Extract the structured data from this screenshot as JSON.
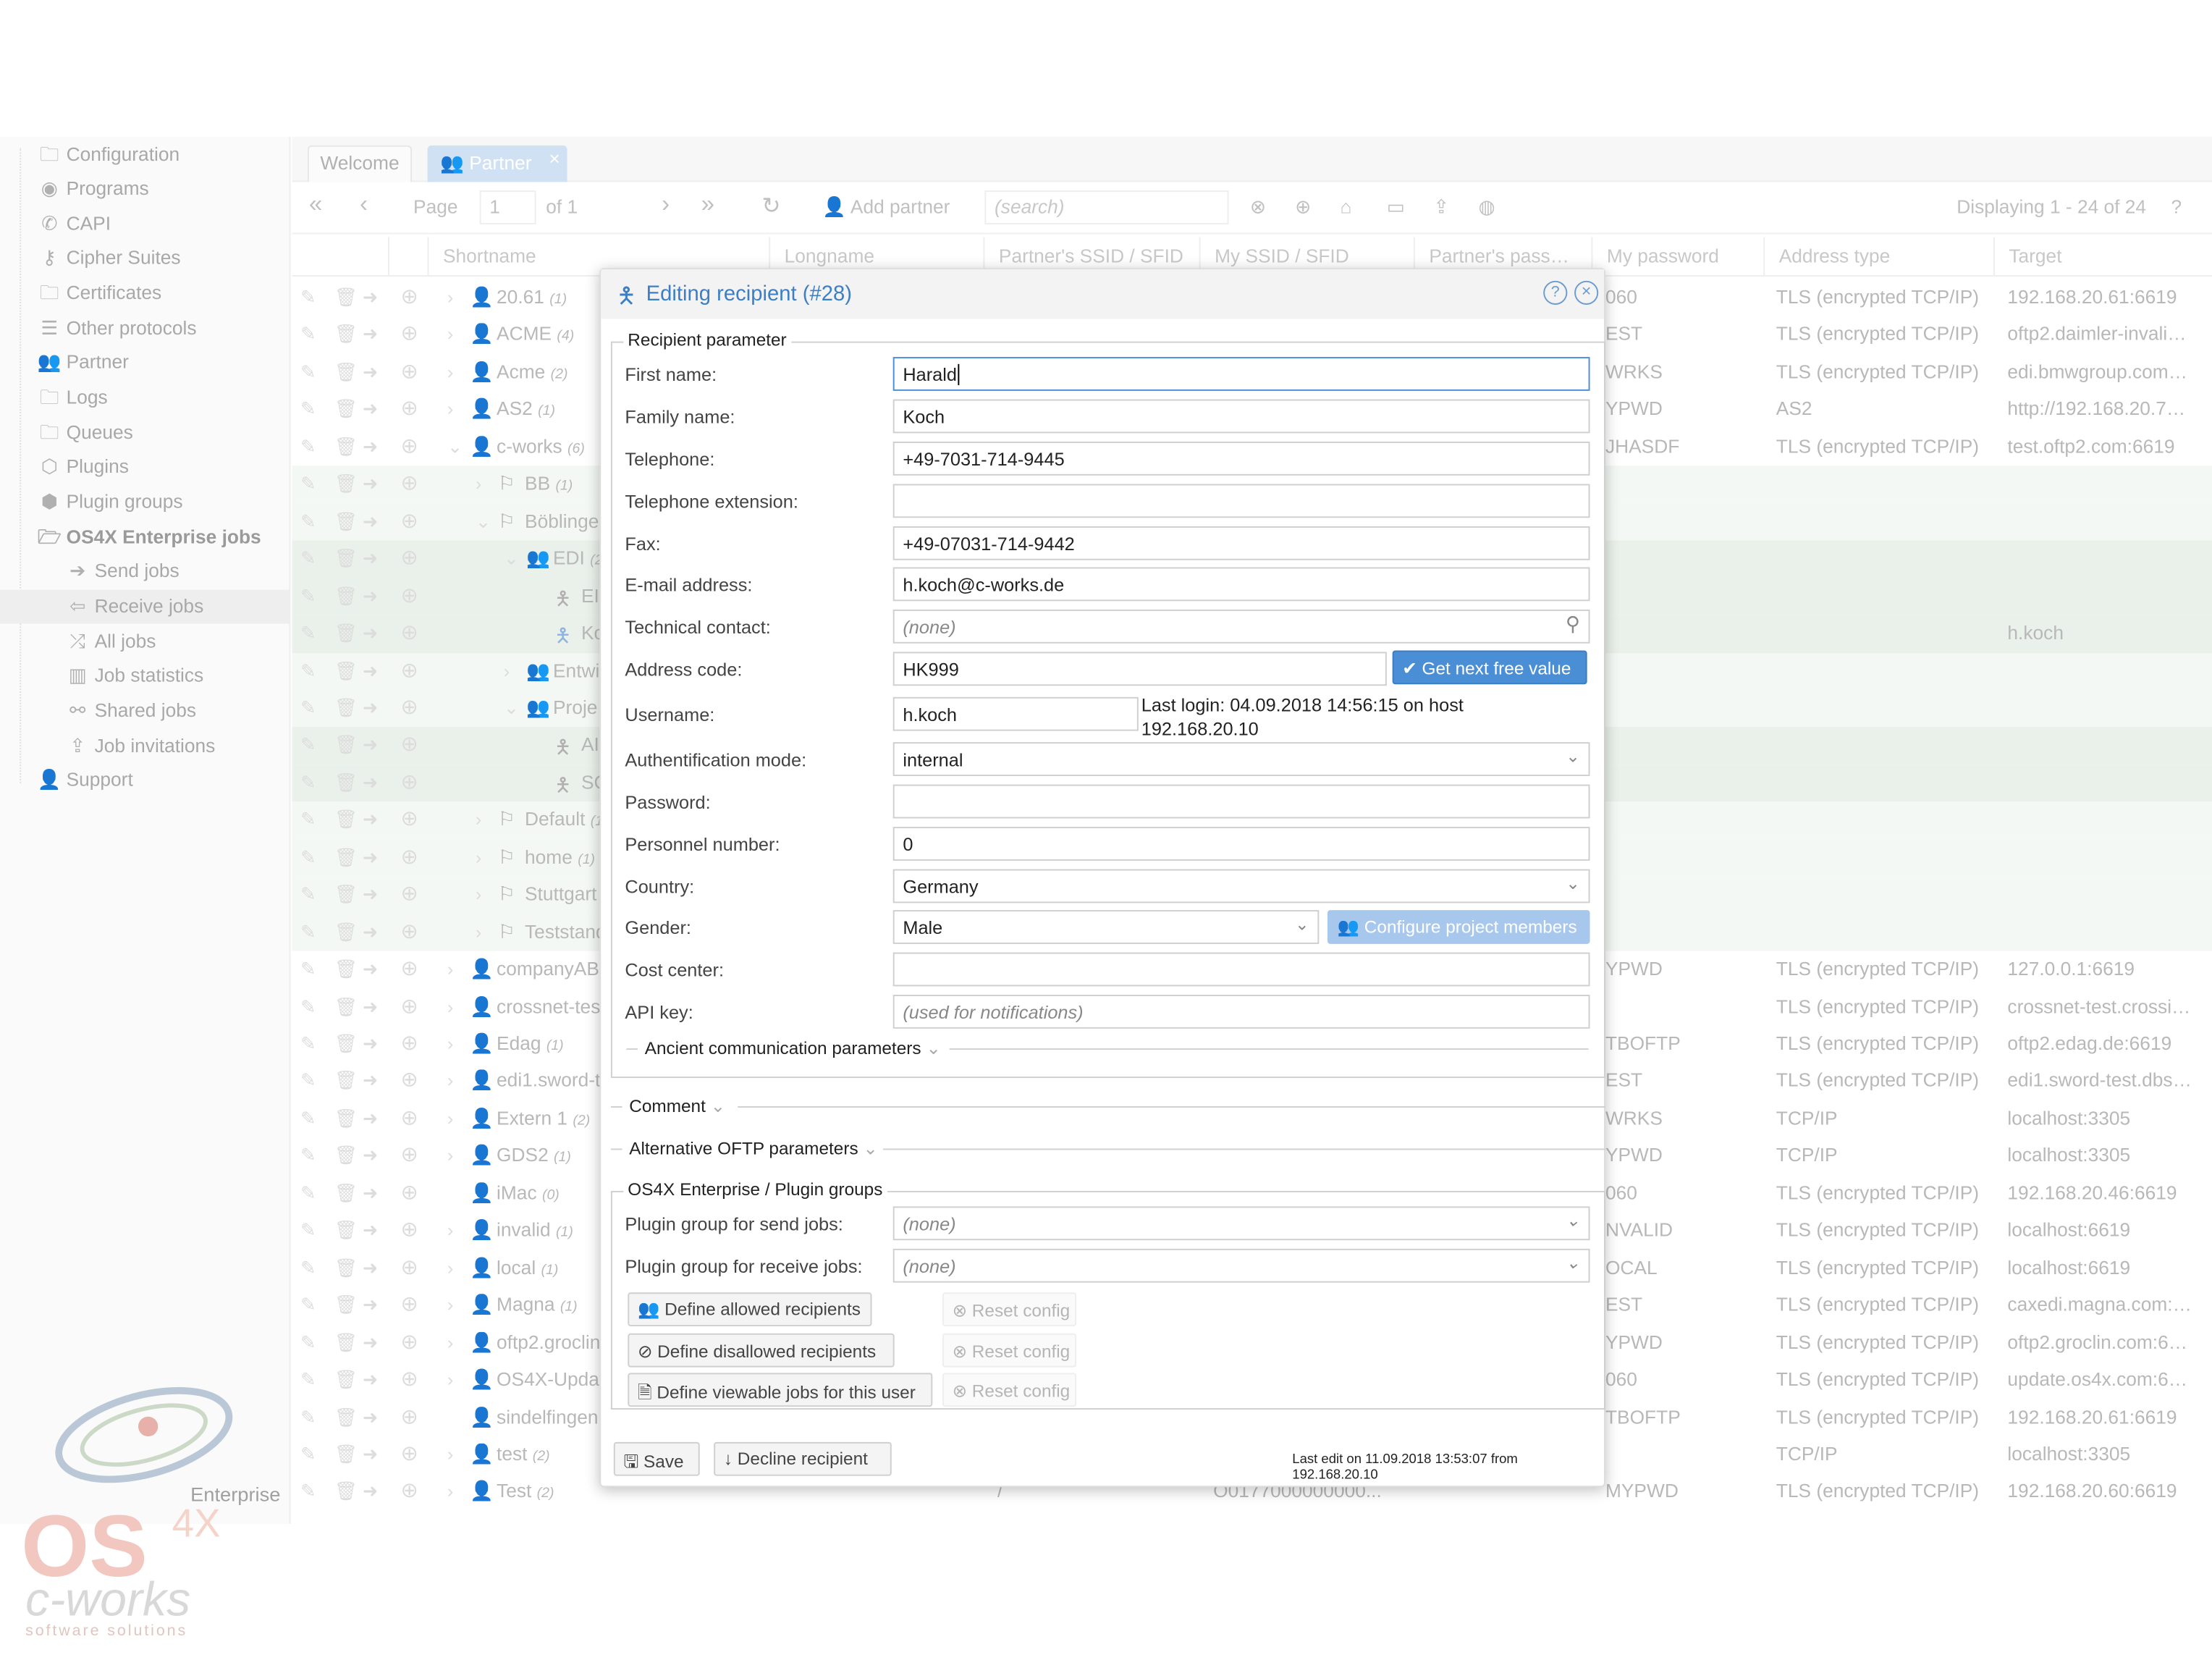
{
  "sidebar": {
    "items": [
      {
        "label": "Configuration",
        "icon": "folder-icon"
      },
      {
        "label": "Programs",
        "icon": "programs-icon"
      },
      {
        "label": "CAPI",
        "icon": "phone-icon"
      },
      {
        "label": "Cipher Suites",
        "icon": "key-icon"
      },
      {
        "label": "Certificates",
        "icon": "folder-icon"
      },
      {
        "label": "Other protocols",
        "icon": "server-icon"
      },
      {
        "label": "Partner",
        "icon": "users-icon"
      },
      {
        "label": "Logs",
        "icon": "folder-icon"
      },
      {
        "label": "Queues",
        "icon": "folder-icon"
      },
      {
        "label": "Plugins",
        "icon": "cube-icon"
      },
      {
        "label": "Plugin groups",
        "icon": "cubes-icon"
      },
      {
        "label": "OS4X Enterprise jobs",
        "icon": "folder-open-icon"
      },
      {
        "label": "Send jobs",
        "icon": "arrow-right-icon"
      },
      {
        "label": "Receive jobs",
        "icon": "arrow-left-icon",
        "selected": true
      },
      {
        "label": "All jobs",
        "icon": "shuffle-icon"
      },
      {
        "label": "Job statistics",
        "icon": "bar-chart-icon"
      },
      {
        "label": "Shared jobs",
        "icon": "share-icon"
      },
      {
        "label": "Job invitations",
        "icon": "upload-icon"
      },
      {
        "label": "Support",
        "icon": "user-icon"
      }
    ],
    "logo": {
      "text": "OS4X",
      "badge": "4X",
      "edition": "Enterprise",
      "company": "c-works",
      "tagline": "software solutions"
    }
  },
  "tabs": [
    {
      "label": "Welcome"
    },
    {
      "label": "Partner",
      "active": true,
      "close": "×"
    }
  ],
  "toolbar": {
    "page_label": "Page",
    "page_value": "1",
    "of_label": "of 1",
    "add_partner": "Add partner",
    "search_placeholder": "(search)",
    "displaying": "Displaying 1 - 24 of 24"
  },
  "grid": {
    "columns": [
      "Shortname",
      "Longname",
      "Partner's SSID / SFID",
      "My SSID / SFID",
      "Partner's pass…",
      "My password",
      "Address type",
      "Target"
    ],
    "rows": [
      {
        "name": "20.61",
        "count": "(1)",
        "level": 0,
        "type": "partner",
        "pwd": "060",
        "addr": "TLS (encrypted TCP/IP)",
        "target": "192.168.20.61:6619"
      },
      {
        "name": "ACME",
        "count": "(4)",
        "level": 0,
        "type": "partner",
        "pwd": "EST",
        "addr": "TLS (encrypted TCP/IP)",
        "target": "oftp2.daimler-invali…"
      },
      {
        "name": "Acme",
        "count": "(2)",
        "level": 0,
        "type": "partner",
        "pwd": "WRKS",
        "addr": "TLS (encrypted TCP/IP)",
        "target": "edi.bmwgroup.com…"
      },
      {
        "name": "AS2",
        "count": "(1)",
        "level": 0,
        "type": "partner",
        "pwd": "YPWD",
        "addr": "AS2",
        "target": "http://192.168.20.7…"
      },
      {
        "name": "c-works",
        "count": "(6)",
        "level": 0,
        "type": "partner",
        "expanded": true,
        "pwd": "JHASDF",
        "addr": "TLS (encrypted TCP/IP)",
        "target": "test.oftp2.com:6619"
      },
      {
        "name": "BB",
        "count": "(1)",
        "level": 1,
        "type": "flag",
        "tint": 1
      },
      {
        "name": "Böblingen",
        "count": "",
        "level": 1,
        "type": "flag",
        "expanded": true,
        "tint": 1
      },
      {
        "name": "EDI",
        "count": "(2)",
        "level": 2,
        "type": "group",
        "expanded": true,
        "tint": 2
      },
      {
        "name": "EI",
        "count": "",
        "level": 3,
        "type": "person",
        "tint": 2
      },
      {
        "name": "Ko",
        "count": "",
        "level": 3,
        "type": "person",
        "blue": true,
        "tint": 2,
        "target": "h.koch"
      },
      {
        "name": "Entwi",
        "count": "",
        "level": 2,
        "type": "group",
        "tint": 1
      },
      {
        "name": "Proje",
        "count": "",
        "level": 2,
        "type": "group",
        "expanded": true,
        "tint": 1
      },
      {
        "name": "AI",
        "count": "",
        "level": 3,
        "type": "person",
        "tint": 2
      },
      {
        "name": "SC",
        "count": "",
        "level": 3,
        "type": "person",
        "tint": 2
      },
      {
        "name": "Default",
        "count": "(1)",
        "level": 1,
        "type": "flag",
        "tint": 1
      },
      {
        "name": "home",
        "count": "(1)",
        "level": 1,
        "type": "flag",
        "tint": 1
      },
      {
        "name": "Stuttgart",
        "count": "",
        "level": 1,
        "type": "flag",
        "tint": 1
      },
      {
        "name": "Teststand",
        "count": "",
        "level": 1,
        "type": "flag",
        "tint": 1
      },
      {
        "name": "companyAB",
        "count": "",
        "level": 0,
        "type": "partner",
        "pwd": "YPWD",
        "addr": "TLS (encrypted TCP/IP)",
        "target": "127.0.0.1:6619"
      },
      {
        "name": "crossnet-tes",
        "count": "",
        "level": 0,
        "type": "partner",
        "pwd": "",
        "addr": "TLS (encrypted TCP/IP)",
        "target": "crossnet-test.crossi…"
      },
      {
        "name": "Edag",
        "count": "(1)",
        "level": 0,
        "type": "partner",
        "pwd": "TBOFTP",
        "addr": "TLS (encrypted TCP/IP)",
        "target": "oftp2.edag.de:6619"
      },
      {
        "name": "edi1.sword-t",
        "count": "",
        "level": 0,
        "type": "partner",
        "pwd": "EST",
        "addr": "TLS (encrypted TCP/IP)",
        "target": "edi1.sword-test.dbs…"
      },
      {
        "name": "Extern 1",
        "count": "(2)",
        "level": 0,
        "type": "partner",
        "pwd": "WRKS",
        "addr": "TCP/IP",
        "target": "localhost:3305"
      },
      {
        "name": "GDS2",
        "count": "(1)",
        "level": 0,
        "type": "partner",
        "pwd": "YPWD",
        "addr": "TCP/IP",
        "target": "localhost:3305"
      },
      {
        "name": "iMac",
        "count": "(0)",
        "level": 0,
        "type": "partner",
        "noexp": true,
        "pwd": "060",
        "addr": "TLS (encrypted TCP/IP)",
        "target": "192.168.20.46:6619"
      },
      {
        "name": "invalid",
        "count": "(1)",
        "level": 0,
        "type": "partner",
        "pwd": "NVALID",
        "addr": "TLS (encrypted TCP/IP)",
        "target": "localhost:6619"
      },
      {
        "name": "local",
        "count": "(1)",
        "level": 0,
        "type": "partner",
        "pwd": "OCAL",
        "addr": "TLS (encrypted TCP/IP)",
        "target": "localhost:6619"
      },
      {
        "name": "Magna",
        "count": "(1)",
        "level": 0,
        "type": "partner",
        "pwd": "EST",
        "addr": "TLS (encrypted TCP/IP)",
        "target": "caxedi.magna.com:…"
      },
      {
        "name": "oftp2.groclin",
        "count": "",
        "level": 0,
        "type": "partner",
        "pwd": "YPWD",
        "addr": "TLS (encrypted TCP/IP)",
        "target": "oftp2.groclin.com:6…"
      },
      {
        "name": "OS4X-Updat",
        "count": "",
        "level": 0,
        "type": "partner",
        "pwd": "060",
        "addr": "TLS (encrypted TCP/IP)",
        "target": "update.os4x.com:6…"
      },
      {
        "name": "sindelfingen",
        "count": "",
        "level": 0,
        "type": "partner",
        "noexp": true,
        "pwd": "TBOFTP",
        "addr": "TLS (encrypted TCP/IP)",
        "target": "192.168.20.61:6619"
      },
      {
        "name": "test",
        "count": "(2)",
        "level": 0,
        "type": "partner",
        "pwd": "",
        "addr": "TCP/IP",
        "target": "localhost:3305"
      },
      {
        "name": "Test",
        "count": "(2)",
        "level": 0,
        "type": "partner",
        "longname": "/",
        "myssid": "O0177000000000...",
        "pwd": "MYPWD",
        "addr": "TLS (encrypted TCP/IP)",
        "target": "192.168.20.60:6619"
      }
    ]
  },
  "modal": {
    "title": "Editing recipient (#28)",
    "section_recipient": "Recipient parameter",
    "fields": {
      "first_name": {
        "label": "First name:",
        "value": "Harald"
      },
      "family_name": {
        "label": "Family name:",
        "value": "Koch"
      },
      "telephone": {
        "label": "Telephone:",
        "value": "+49-7031-714-9445"
      },
      "telephone_ext": {
        "label": "Telephone extension:",
        "value": ""
      },
      "fax": {
        "label": "Fax:",
        "value": "+49-07031-714-9442"
      },
      "email": {
        "label": "E-mail address:",
        "value": "h.koch@c-works.de"
      },
      "tech_contact": {
        "label": "Technical contact:",
        "placeholder": "(none)"
      },
      "address_code": {
        "label": "Address code:",
        "value": "HK999",
        "button": "Get next free value"
      },
      "username": {
        "label": "Username:",
        "value": "h.koch",
        "last_login": "Last login: 04.09.2018 14:56:15 on host 192.168.20.10"
      },
      "auth_mode": {
        "label": "Authentification mode:",
        "value": "internal"
      },
      "password": {
        "label": "Password:",
        "value": ""
      },
      "personnel": {
        "label": "Personnel number:",
        "value": "0"
      },
      "country": {
        "label": "Country:",
        "value": "Germany"
      },
      "gender": {
        "label": "Gender:",
        "value": "Male",
        "button": "Configure project members"
      },
      "cost_center": {
        "label": "Cost center:",
        "value": ""
      },
      "api_key": {
        "label": "API key:",
        "placeholder": "(used for notifications)"
      }
    },
    "ancient": "Ancient communication parameters",
    "comment": "Comment",
    "alt_oftp": "Alternative OFTP parameters",
    "enterprise": {
      "title": "OS4X Enterprise / Plugin groups",
      "send_label": "Plugin group for send jobs:",
      "send_value": "(none)",
      "recv_label": "Plugin group for receive jobs:",
      "recv_value": "(none)",
      "allowed": "Define allowed recipients",
      "disallowed": "Define disallowed recipients",
      "viewable": "Define viewable jobs for this user",
      "reset": "Reset config"
    },
    "save": "Save",
    "decline": "Decline recipient",
    "last_edit": "Last edit on 11.09.2018 13:53:07 from 192.168.20.10"
  },
  "colors": {
    "accent": "#3d7fc6",
    "button": "#4a8fd6"
  }
}
